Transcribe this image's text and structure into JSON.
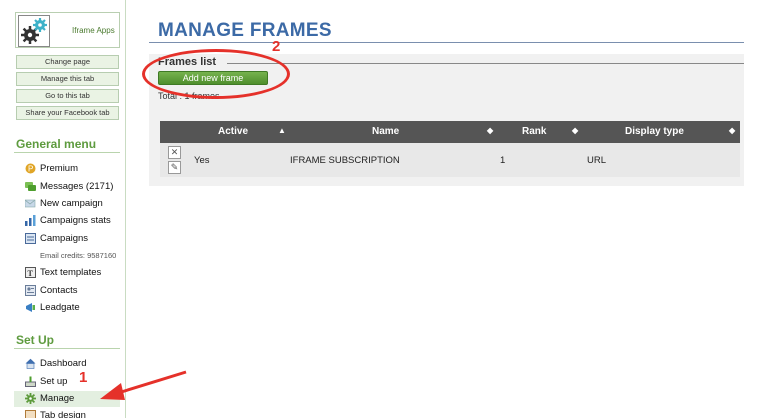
{
  "app": {
    "name": "Iframe Apps"
  },
  "sidebar": {
    "buttons": [
      "Change page",
      "Manage this tab",
      "Go to this tab",
      "Share your Facebook tab"
    ],
    "general_title": "General menu",
    "general_items": [
      {
        "label": "Premium",
        "icon": "premium-icon"
      },
      {
        "label": "Messages (2171)",
        "icon": "messages-icon"
      },
      {
        "label": "New campaign",
        "icon": "new-campaign-icon"
      },
      {
        "label": "Campaigns stats",
        "icon": "stats-icon"
      },
      {
        "label": "Campaigns",
        "icon": "campaigns-icon"
      }
    ],
    "email_credits": "Email credits: 9587160",
    "general_items_2": [
      {
        "label": "Text templates",
        "icon": "text-templates-icon"
      },
      {
        "label": "Contacts",
        "icon": "contacts-icon"
      },
      {
        "label": "Leadgate",
        "icon": "leadgate-icon"
      }
    ],
    "setup_title": "Set Up",
    "setup_items": [
      {
        "label": "Dashboard",
        "icon": "home-icon"
      },
      {
        "label": "Set up",
        "icon": "setup-icon"
      },
      {
        "label": "Manage",
        "icon": "gear-icon"
      },
      {
        "label": "Tab design",
        "icon": "tab-design-icon"
      }
    ]
  },
  "main": {
    "title": "MANAGE FRAMES",
    "legend": "Frames list",
    "add_button": "Add new frame",
    "total": "Total : 1 frames",
    "columns": [
      "Active",
      "Name",
      "Rank",
      "Display type"
    ],
    "rows": [
      {
        "active": "Yes",
        "name": "IFRAME SUBSCRIPTION",
        "rank": "1",
        "display_type": "URL"
      }
    ]
  },
  "annotations": {
    "step1": "1",
    "step2": "2"
  },
  "colors": {
    "accent_green": "#5e9b3f",
    "title_blue": "#3c6aa6",
    "annotation_red": "#e5312a"
  }
}
